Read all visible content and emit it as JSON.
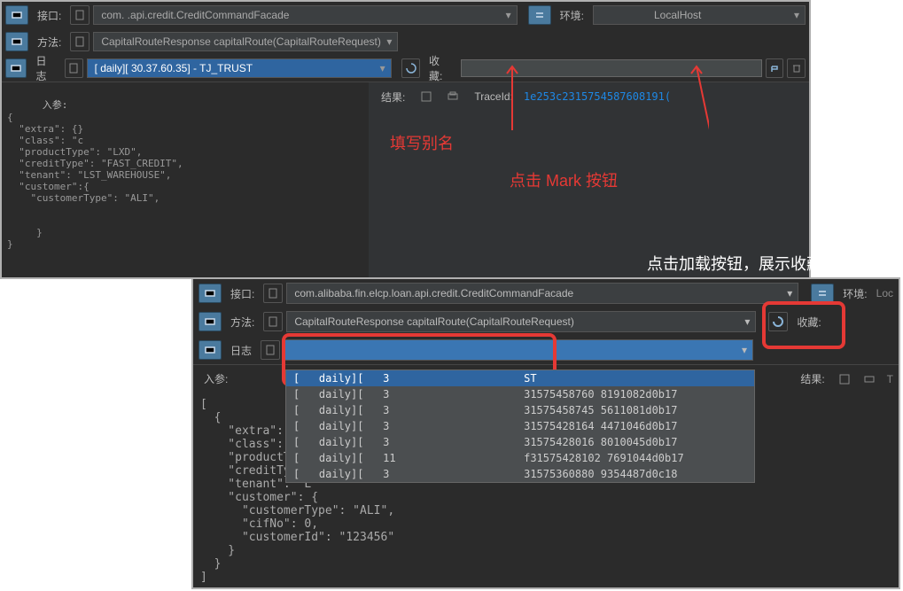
{
  "panel1": {
    "interface_label": "接口:",
    "interface_value": "com.                         .api.credit.CreditCommandFacade",
    "env_label": "环境:",
    "env_value": "LocalHost",
    "method_label": "方法:",
    "method_value": "CapitalRouteResponse capitalRoute(CapitalRouteRequest)",
    "log_label": "日志",
    "log_value": "[   daily][   30.37.60.35] - TJ_TRUST",
    "fav_label": "收藏:",
    "input_label": "入参:",
    "result_label": "结果:",
    "traceid_label": "TraceId:",
    "traceid_value": "1e253c2315754587608191(",
    "code": "{\n  \"extra\": {}\n  \"class\": \"c\n  \"productType\": \"LXD\",\n  \"creditType\": \"FAST_CREDIT\",\n  \"tenant\": \"LST_WAREHOUSE\",\n  \"customer\":{\n    \"customerType\": \"ALI\",\n\n\n     }\n}"
  },
  "panel2": {
    "interface_label": "接口:",
    "interface_value": "com.alibaba.fin.elcp.loan.api.credit.CreditCommandFacade",
    "env_label": "环境:",
    "method_label": "方法:",
    "method_value": "CapitalRouteResponse capitalRoute(CapitalRouteRequest)",
    "log_label": "日志",
    "fav_label": "收藏:",
    "input_label": "入参:",
    "result_label": "结果:",
    "list": [
      {
        "a": "[   daily][   3",
        "b": "ST"
      },
      {
        "a": "[   daily][   3",
        "b": "31575458760 8191082d0b17"
      },
      {
        "a": "[   daily][   3",
        "b": "31575458745 5611081d0b17"
      },
      {
        "a": "[   daily][   3",
        "b": "31575428164 4471046d0b17"
      },
      {
        "a": "[   daily][   3",
        "b": "31575428016 8010045d0b17"
      },
      {
        "a": "[   daily][   11",
        "b": "f31575428102 7691044d0b17"
      },
      {
        "a": "[   daily][   3",
        "b": "31575360880 9354487d0c18"
      }
    ],
    "code": "[\n  {\n    \"extra\": {},\n    \"class\": \"co\n    \"productTyp\n    \"creditType\n    \"tenant\": \"L\n    \"customer\": {\n      \"customerType\": \"ALI\",\n      \"cifNo\": 0,\n      \"customerId\": \"123456\"\n    }\n  }\n]"
  },
  "ann": {
    "a1": "填写别名",
    "a2": "点击 Mark 按钮",
    "a3": "点击加载按钮，展示收藏列表"
  }
}
